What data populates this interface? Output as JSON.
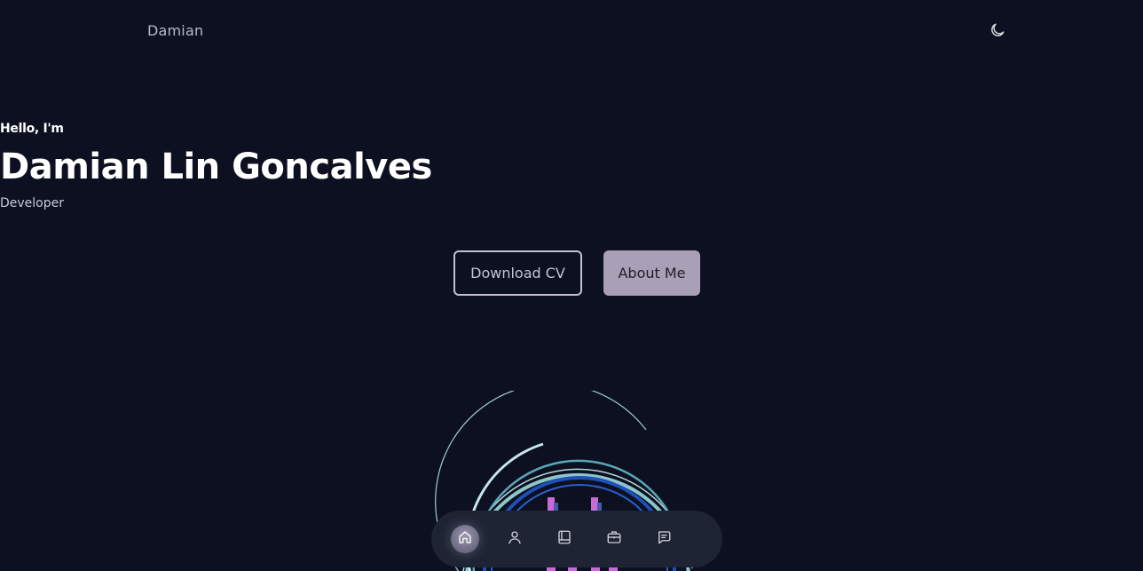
{
  "header": {
    "logo": "Damian",
    "theme_toggle_icon": "moon-icon"
  },
  "hero": {
    "greeting": "Hello, I'm",
    "name": "Damian Lin Goncalves",
    "role": "Developer",
    "buttons": {
      "download_cv": "Download CV",
      "about_me": "About Me"
    }
  },
  "dock": {
    "items": [
      {
        "icon": "home-icon",
        "active": true
      },
      {
        "icon": "user-icon",
        "active": false
      },
      {
        "icon": "book-icon",
        "active": false
      },
      {
        "icon": "briefcase-icon",
        "active": false
      },
      {
        "icon": "message-icon",
        "active": false
      }
    ]
  },
  "colors": {
    "background": "#0c1020",
    "accent_button": "#a99fb6",
    "dock_background": "#1e2434",
    "art_cyan": "#9ad3d6",
    "art_blue": "#1f4fb8",
    "art_magenta": "#c76bd8"
  }
}
